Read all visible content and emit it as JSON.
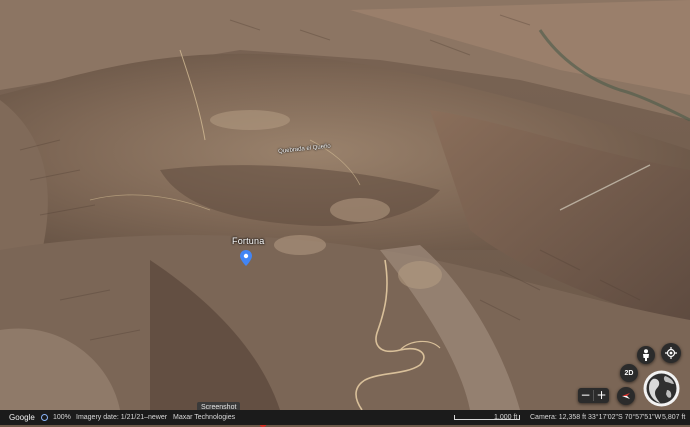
{
  "map": {
    "place_name": "Fortuna",
    "stream_name": "Quebrada el Queño"
  },
  "controls": {
    "view_2d_label": "2D",
    "zoom_out_label": "−",
    "zoom_in_label": "+",
    "street_view_icon": "person-icon",
    "locate_icon": "my-location-icon",
    "compass_icon": "north-arrow-icon",
    "globe_icon": "globe-icon"
  },
  "tooltip": {
    "text": "Screenshot"
  },
  "status_bar": {
    "logo": "Google",
    "zoom_percent": "100%",
    "imagery_date": "Imagery date: 1/21/21–newer",
    "credit": "Maxar Technologies",
    "scale_label": "1,000 ft",
    "camera": "Camera: 12,358 ft",
    "coordinates": "33°17'02\"S 70°57'51\"W",
    "elevation": "5,807 ft"
  },
  "colors": {
    "status_bar_bg": "#1b1b1b",
    "pin_blue": "#4285f4",
    "accent_blue": "#8ab4f8"
  }
}
